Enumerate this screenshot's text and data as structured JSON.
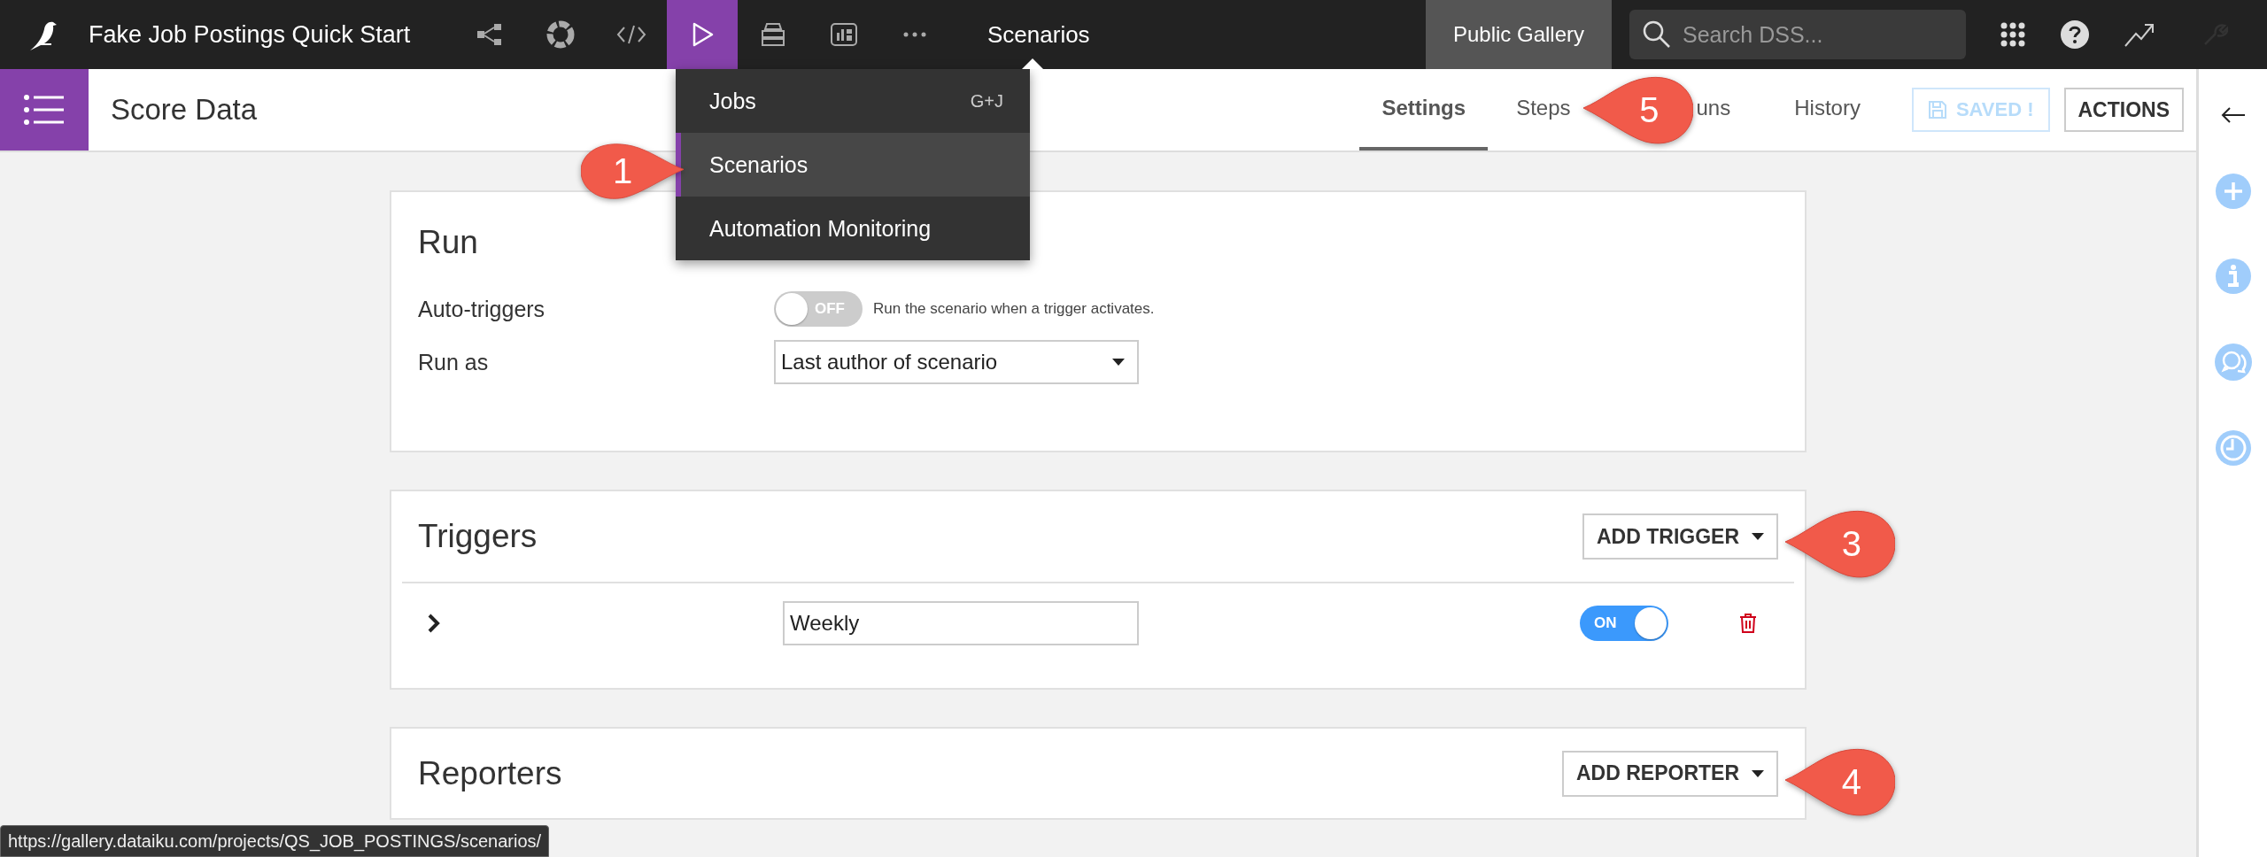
{
  "topbar": {
    "title": "Fake Job Postings Quick Start",
    "nav": [
      {
        "kind": "flow",
        "selected": false
      },
      {
        "kind": "ring",
        "selected": false
      },
      {
        "kind": "code",
        "selected": false
      },
      {
        "kind": "play",
        "selected": true
      },
      {
        "kind": "stack",
        "selected": false
      },
      {
        "kind": "dashboard",
        "selected": false
      },
      {
        "kind": "more",
        "selected": false
      }
    ],
    "section": "Scenarios",
    "gallery_button": "Public Gallery",
    "search": {
      "placeholder": "Search DSS..."
    }
  },
  "nav_menu": {
    "items": [
      {
        "label": "Jobs",
        "shortcut": "G+J",
        "selected": false
      },
      {
        "label": "Scenarios",
        "selected": true
      },
      {
        "label": "Automation Monitoring",
        "selected": false
      }
    ]
  },
  "header": {
    "title": "Score Data",
    "tabs": [
      {
        "label": "Settings",
        "selected": true
      },
      {
        "label": "Steps",
        "selected": false
      },
      {
        "label": "uns",
        "selected": false
      },
      {
        "label": "History",
        "selected": false
      }
    ],
    "saved_button": {
      "label": "SAVED !",
      "disabled": true
    },
    "actions_button": "ACTIONS"
  },
  "run": {
    "title": "Run",
    "auto_triggers": {
      "label": "Auto-triggers",
      "on": false,
      "state_text": "OFF",
      "hint": "Run the scenario when a trigger activates."
    },
    "run_as": {
      "label": "Run as",
      "value": "Last author of scenario"
    }
  },
  "triggers": {
    "title": "Triggers",
    "add_button": "ADD TRIGGER",
    "items": [
      {
        "name": "Weekly",
        "on": true,
        "state_text": "ON",
        "expanded": false
      }
    ]
  },
  "reporters": {
    "title": "Reporters",
    "add_button": "ADD REPORTER"
  },
  "callouts": [
    {
      "number": "1",
      "kind": "menu"
    },
    {
      "number": "5",
      "kind": "tabs"
    },
    {
      "number": "3",
      "kind": "triggers"
    },
    {
      "number": "4",
      "kind": "reporters"
    }
  ],
  "status_url": "https://gallery.dataiku.com/projects/QS_JOB_POSTINGS/scenarios/"
}
